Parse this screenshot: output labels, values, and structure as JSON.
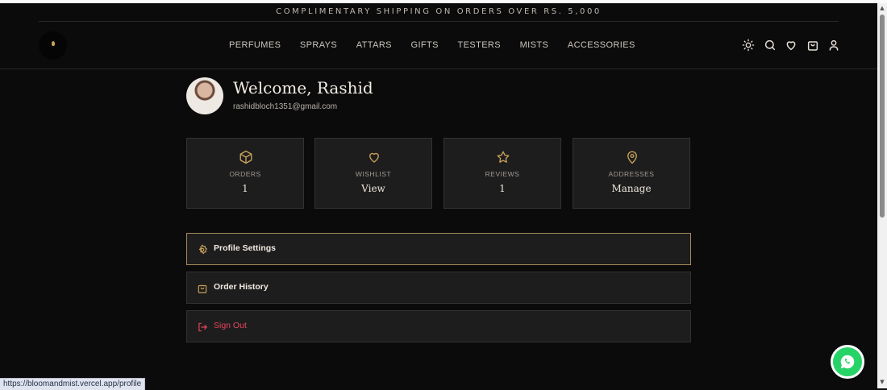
{
  "announcement": "COMPLIMENTARY SHIPPING ON ORDERS OVER RS. 5,000",
  "nav": {
    "items": [
      "PERFUMES",
      "SPRAYS",
      "ATTARS",
      "GIFTS",
      "TESTERS",
      "MISTS",
      "ACCESSORIES"
    ]
  },
  "header_icons": [
    "sun-icon",
    "search-icon",
    "heart-icon",
    "bag-icon",
    "user-icon"
  ],
  "profile": {
    "welcome": "Welcome, Rashid",
    "email": "rashidbloch1351@gmail.com"
  },
  "stats": [
    {
      "icon": "box-icon",
      "label": "ORDERS",
      "value": "1"
    },
    {
      "icon": "heart-icon",
      "label": "WISHLIST",
      "value": "View"
    },
    {
      "icon": "star-icon",
      "label": "REVIEWS",
      "value": "1"
    },
    {
      "icon": "map-pin-icon",
      "label": "ADDRESSES",
      "value": "Manage"
    }
  ],
  "menu": [
    {
      "icon": "gear-icon",
      "label": "Profile Settings"
    },
    {
      "icon": "bag-icon",
      "label": "Order History"
    },
    {
      "icon": "sign-out-icon",
      "label": "Sign Out"
    }
  ],
  "status_url": "https://bloomandmist.vercel.app/profile",
  "colors": {
    "background": "#0c0b0c",
    "card": "#1e1d1e",
    "accent_gold": "#c9a25a",
    "danger": "#e4455a",
    "whatsapp": "#25d366"
  }
}
